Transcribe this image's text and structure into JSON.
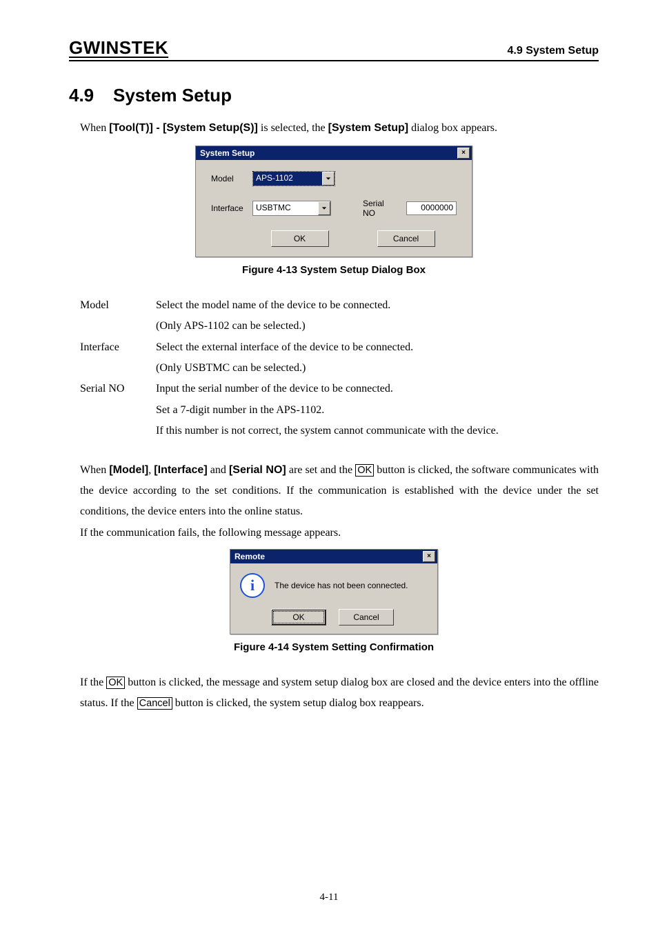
{
  "header": {
    "brand": "GWINSTEK",
    "right": "4.9 System Setup"
  },
  "heading": {
    "number": "4.9",
    "title": "System Setup"
  },
  "intro": {
    "t1": "When ",
    "menu": "[Tool(T)] - [System Setup(S)]",
    "t2": " is selected, the ",
    "dlgname": "[System Setup]",
    "t3": " dialog box appears."
  },
  "dlg1": {
    "title": "System Setup",
    "close": "×",
    "model_label": "Model",
    "model_value": "APS-1102",
    "interface_label": "Interface",
    "interface_value": "USBTMC",
    "serial_label": "Serial NO",
    "serial_value": "0000000",
    "ok": "OK",
    "cancel": "Cancel"
  },
  "fig1_caption": "Figure 4-13  System Setup Dialog Box",
  "definitions": {
    "model": {
      "label": "Model",
      "line1": "Select the model name of the device to be connected.",
      "line2": "(Only APS-1102 can be selected.)"
    },
    "interface": {
      "label": "Interface",
      "line1": "Select the external interface of the device to be connected.",
      "line2": "(Only USBTMC can be selected.)"
    },
    "serial": {
      "label": "Serial NO",
      "line1": "Input the serial number of the device to be connected.",
      "line2": "Set a 7-digit number in the APS-1102.",
      "line3": "If this number is not correct, the system cannot communicate with the device."
    }
  },
  "para2": {
    "t1": "When ",
    "b1": "[Model]",
    "t2": ", ",
    "b2": "[Interface]",
    "t3": " and ",
    "b3": "[Serial NO]",
    "t4": " are set and the ",
    "ok_key": "OK",
    "t5": " button is clicked, the software communicates with the device according to the set conditions. If the communication is established with the device under the set conditions, the device enters into the online status.",
    "t6": "If the communication fails, the following message appears."
  },
  "dlg2": {
    "title": "Remote",
    "close": "×",
    "icon_letter": "i",
    "message": "The device has not been connected.",
    "ok": "OK",
    "cancel": "Cancel"
  },
  "fig2_caption": "Figure 4-14  System Setting Confirmation",
  "para3": {
    "t1": "If the ",
    "ok_key": "OK",
    "t2": " button is clicked, the message and system setup dialog box are closed and the device enters into the offline status. If the ",
    "cancel_key": "Cancel",
    "t3": " button is clicked, the system setup dialog box reappears."
  },
  "page_number": "4-11"
}
